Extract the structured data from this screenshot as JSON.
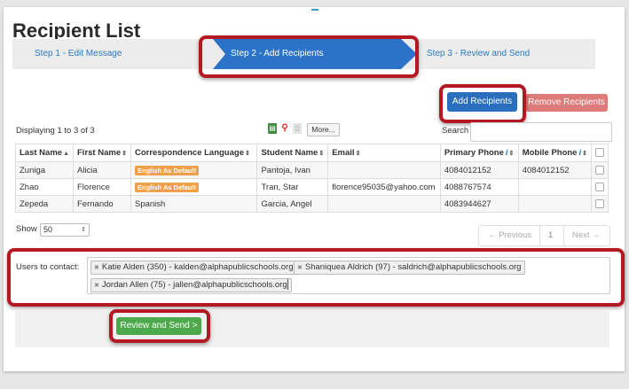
{
  "page": {
    "title": "Recipient List"
  },
  "steps": [
    {
      "label": "Step 1 - Edit Message"
    },
    {
      "label": "Step 2 - Add Recipients"
    },
    {
      "label": "Step 3 - Review and Send"
    }
  ],
  "actions": {
    "add": "Add Recipients",
    "remove": "Remove Recipients"
  },
  "list": {
    "displaying": "Displaying 1 to 3 of 3",
    "more": "More...",
    "search_label": "Search",
    "search_value": "",
    "columns": [
      "Last Name",
      "First Name",
      "Correspondence Language",
      "Student Name",
      "Email",
      "Primary Phone",
      "Mobile Phone"
    ],
    "rows": [
      {
        "last": "Zuniga",
        "first": "Alicia",
        "language": "English As Default",
        "student": "Pantoja, Ivan",
        "email": "",
        "primary": "4084012152",
        "mobile": "4084012152"
      },
      {
        "last": "Zhao",
        "first": "Florence",
        "language": "English As Default",
        "student": "Tran, Star",
        "email": "florence95035@yahoo.com",
        "primary": "4088767574",
        "mobile": ""
      },
      {
        "last": "Zepeda",
        "first": "Fernando",
        "language": "Spanish",
        "student": "Garcia, Angel",
        "email": "",
        "primary": "4083944627",
        "mobile": ""
      }
    ],
    "show_label": "Show",
    "show_value": "50",
    "pager": {
      "prev": "← Previous",
      "page": "1",
      "next": "Next →"
    }
  },
  "contacts": {
    "label": "Users to contact:",
    "chips": [
      "Katie Alden (350) - kalden@alphapublicschools.org",
      "Shaniquea Aldrich (97) - saldrich@alphapublicschools.org",
      "Jordan Allen (75) - jallen@alphapublicschools.org"
    ]
  },
  "footer": {
    "review": "Review and Send >"
  },
  "colors": {
    "accent": "#2a6fbd",
    "highlight": "#b41820",
    "step_active": "#2a73c8",
    "tag": "#f0a04a",
    "success": "#4caa4c",
    "danger": "#dd7a7a"
  }
}
